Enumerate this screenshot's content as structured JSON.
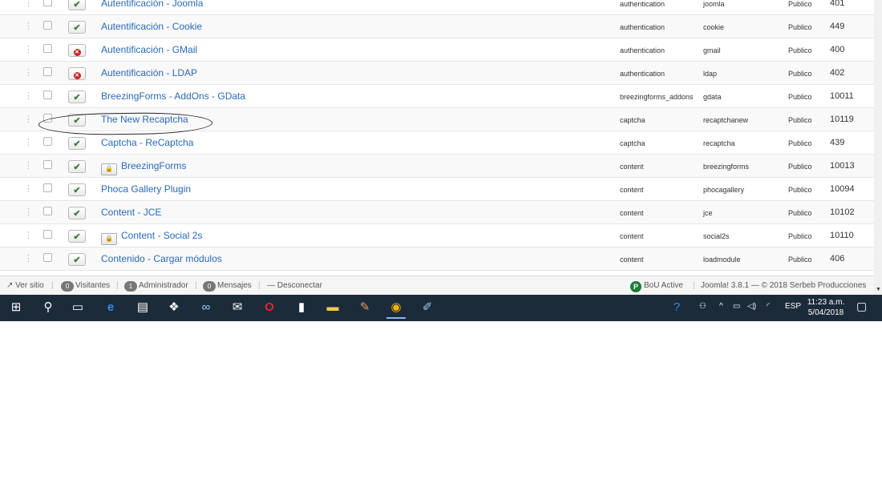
{
  "plugins": [
    {
      "name": "Autentificación - Joomla",
      "enabled": true,
      "locked": false,
      "folder": "authentication",
      "element": "joomla",
      "access": "Publico",
      "id": "401"
    },
    {
      "name": "Autentificación - Cookie",
      "enabled": true,
      "locked": false,
      "folder": "authentication",
      "element": "cookie",
      "access": "Publico",
      "id": "449"
    },
    {
      "name": "Autentificación - GMail",
      "enabled": false,
      "locked": false,
      "folder": "authentication",
      "element": "gmail",
      "access": "Publico",
      "id": "400"
    },
    {
      "name": "Autentificación - LDAP",
      "enabled": false,
      "locked": false,
      "folder": "authentication",
      "element": "ldap",
      "access": "Publico",
      "id": "402"
    },
    {
      "name": "BreezingForms - AddOns - GData",
      "enabled": true,
      "locked": false,
      "folder": "breezingforms_addons",
      "element": "gdata",
      "access": "Publico",
      "id": "10011"
    },
    {
      "name": "The New Recaptcha",
      "enabled": true,
      "locked": false,
      "folder": "captcha",
      "element": "recaptchanew",
      "access": "Publico",
      "id": "10119"
    },
    {
      "name": "Captcha - ReCaptcha",
      "enabled": true,
      "locked": false,
      "folder": "captcha",
      "element": "recaptcha",
      "access": "Publico",
      "id": "439"
    },
    {
      "name": "BreezingForms",
      "enabled": true,
      "locked": true,
      "folder": "content",
      "element": "breezingforms",
      "access": "Publico",
      "id": "10013"
    },
    {
      "name": "Phoca Gallery Plugin",
      "enabled": true,
      "locked": false,
      "folder": "content",
      "element": "phocagallery",
      "access": "Publico",
      "id": "10094"
    },
    {
      "name": "Content - JCE",
      "enabled": true,
      "locked": false,
      "folder": "content",
      "element": "jce",
      "access": "Publico",
      "id": "10102"
    },
    {
      "name": "Content - Social 2s",
      "enabled": true,
      "locked": true,
      "folder": "content",
      "element": "social2s",
      "access": "Publico",
      "id": "10110"
    },
    {
      "name": "Contenido - Cargar módulos",
      "enabled": true,
      "locked": false,
      "folder": "content",
      "element": "loadmodule",
      "access": "Publico",
      "id": "406"
    }
  ],
  "statusbar": {
    "view_site": "Ver sitio",
    "visitors_count": "0",
    "visitors_label": "Visitantes",
    "admin_count": "1",
    "admin_label": "Administrador",
    "messages_count": "0",
    "messages_label": "Mensajes",
    "logout": "Desconectar",
    "bou_icon_letter": "P",
    "bou_label": "BoU Active",
    "footer": "Joomla! 3.8.1 — © 2018 Serbeb Producciones"
  },
  "taskbar": {
    "keyboard_lang": "ESP",
    "time": "11:23 a.m.",
    "date": "5/04/2018",
    "icons": [
      "windows-start-icon",
      "search-icon",
      "task-view-icon",
      "edge-icon",
      "store-icon",
      "dropbox-icon",
      "infinity-icon",
      "mail-icon",
      "opera-icon",
      "file-icon",
      "file-explorer-icon",
      "app-icon",
      "chrome-icon",
      "paint-icon"
    ]
  },
  "colors": {
    "link": "#2a69b8",
    "taskbar": "#1c2b3a",
    "enabled": "#3c7d3c",
    "disabled": "#c42727"
  }
}
